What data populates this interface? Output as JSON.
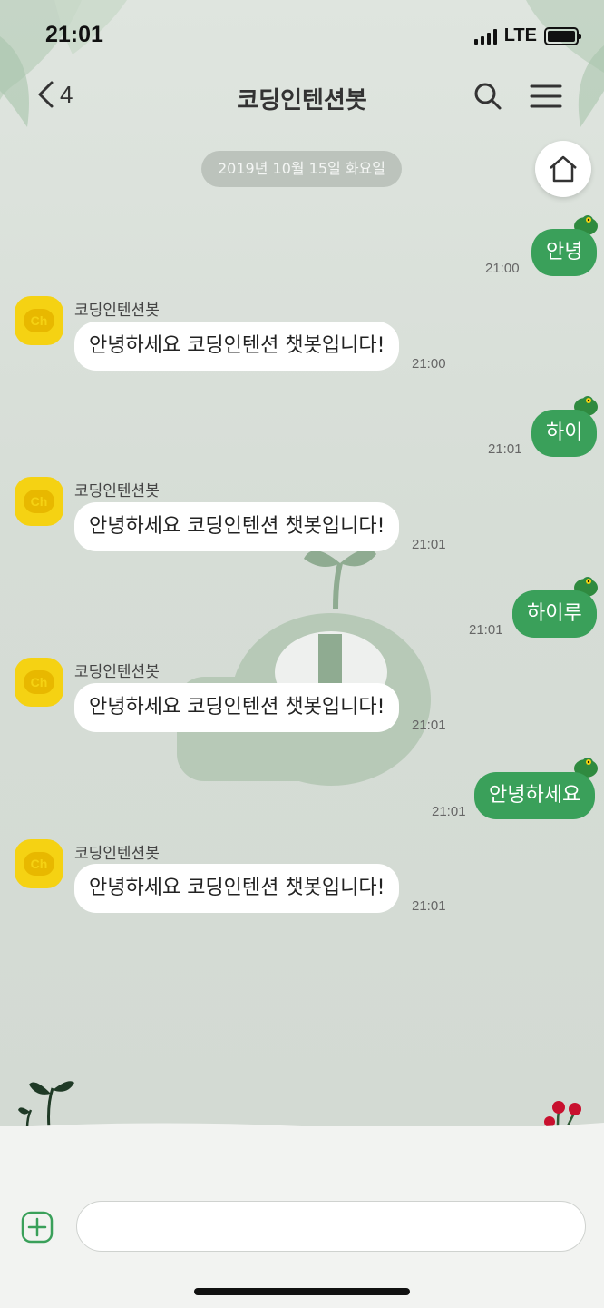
{
  "status_bar": {
    "time": "21:01",
    "network": "LTE"
  },
  "header": {
    "back_count": "4",
    "title": "코딩인텐션봇"
  },
  "date_divider": "2019년 10월 15일 화요일",
  "messages": [
    {
      "dir": "out",
      "text": "안녕",
      "time": "21:00"
    },
    {
      "dir": "in",
      "sender": "코딩인텐션봇",
      "text": "안녕하세요 코딩인텐션 챗봇입니다!",
      "time": "21:00"
    },
    {
      "dir": "out",
      "text": "하이",
      "time": "21:01"
    },
    {
      "dir": "in",
      "sender": "코딩인텐션봇",
      "text": "안녕하세요 코딩인텐션 챗봇입니다!",
      "time": "21:01"
    },
    {
      "dir": "out",
      "text": "하이루",
      "time": "21:01"
    },
    {
      "dir": "in",
      "sender": "코딩인텐션봇",
      "text": "안녕하세요 코딩인텐션 챗봇입니다!",
      "time": "21:01"
    },
    {
      "dir": "out",
      "text": "안녕하세요",
      "time": "21:01"
    },
    {
      "dir": "in",
      "sender": "코딩인텐션봇",
      "text": "안녕하세요 코딩인텐션 챗봇입니다!",
      "time": "21:01"
    }
  ],
  "avatar_label": "Ch",
  "composer": {
    "placeholder": ""
  },
  "colors": {
    "outgoing_bubble": "#3aa05a",
    "accent": "#3aa05a",
    "avatar": "#f5d213"
  },
  "icons": [
    "chevron-left-icon",
    "search-icon",
    "menu-icon",
    "home-icon",
    "plus-icon",
    "frog-sticker-icon",
    "channel-avatar-icon"
  ]
}
